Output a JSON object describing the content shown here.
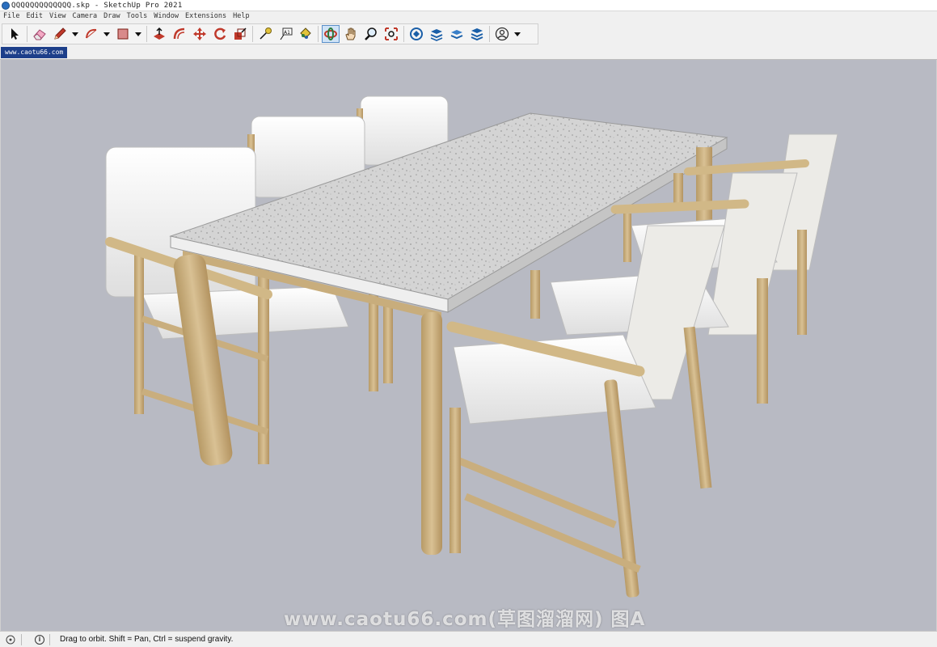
{
  "window": {
    "title": "QQQQQQQQQQQQQ.skp - SketchUp Pro 2021"
  },
  "menu": {
    "items": [
      {
        "label": "File"
      },
      {
        "label": "Edit"
      },
      {
        "label": "View"
      },
      {
        "label": "Camera"
      },
      {
        "label": "Draw"
      },
      {
        "label": "Tools"
      },
      {
        "label": "Window"
      },
      {
        "label": "Extensions"
      },
      {
        "label": "Help"
      }
    ]
  },
  "toolbar": {
    "tools": [
      {
        "name": "select-icon"
      },
      {
        "name": "eraser-icon"
      },
      {
        "name": "pencil-icon"
      },
      {
        "name": "arc-icon"
      },
      {
        "name": "rectangle-icon"
      },
      {
        "name": "push-pull-icon"
      },
      {
        "name": "offset-icon"
      },
      {
        "name": "move-icon"
      },
      {
        "name": "rotate-icon"
      },
      {
        "name": "scale-icon"
      },
      {
        "name": "tape-measure-icon"
      },
      {
        "name": "text-icon"
      },
      {
        "name": "paint-bucket-icon"
      },
      {
        "name": "orbit-icon"
      },
      {
        "name": "pan-icon"
      },
      {
        "name": "zoom-icon"
      },
      {
        "name": "zoom-extents-icon"
      },
      {
        "name": "warehouse-icon"
      },
      {
        "name": "extension-warehouse-icon"
      },
      {
        "name": "layout-icon"
      },
      {
        "name": "extension-manager-icon"
      },
      {
        "name": "account-icon"
      }
    ],
    "text_tool_label": "A1",
    "active_tool": "orbit-icon"
  },
  "scene_tab": {
    "label": "www.caotu66.com"
  },
  "viewport": {
    "background": "#b8bac3",
    "watermark": "www.caotu66.com(草图溜溜网) 图A"
  },
  "status": {
    "text": "Drag to orbit. Shift = Pan, Ctrl = suspend gravity."
  },
  "colors": {
    "wood": "#c9ae7e",
    "cushion": "#f2f2f2",
    "tabletop": "#d2d2d2",
    "accent": "#1d3f8a"
  }
}
